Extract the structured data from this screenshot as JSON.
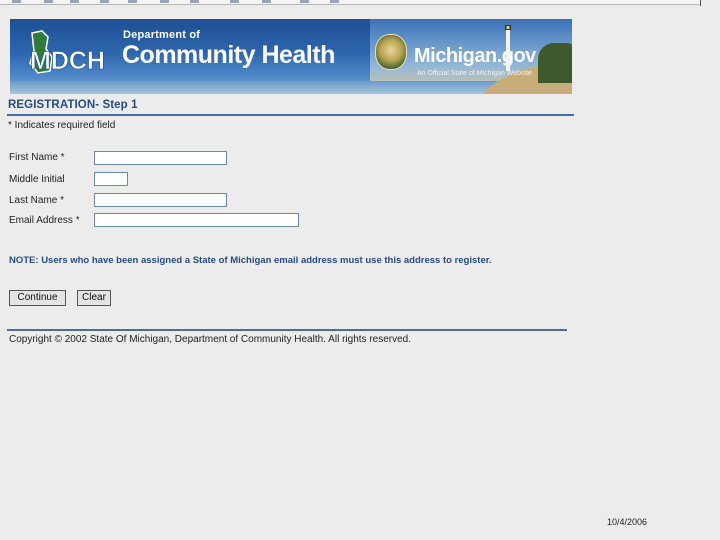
{
  "banner": {
    "mdch_logo": "MDCH",
    "dept_small": "Department of",
    "dept_big": "Community Health",
    "michigan_gov": "Michigan.gov",
    "michigan_tagline": "An Official State of Michigan Website"
  },
  "page": {
    "heading": "REGISTRATION- Step 1",
    "required_note": "* Indicates required field"
  },
  "form": {
    "first_name_label": "First Name *",
    "first_name_value": "",
    "middle_initial_label": "Middle Initial",
    "middle_initial_value": "",
    "last_name_label": "Last Name *",
    "last_name_value": "",
    "email_label": "Email Address *",
    "email_value": ""
  },
  "note": {
    "text": "NOTE: Users who have been assigned a State of Michigan email address must use this address to register."
  },
  "buttons": {
    "continue_label": "Continue",
    "clear_label": "Clear"
  },
  "footer": {
    "copyright": "Copyright © 2002 State Of Michigan, Department of Community Health. All rights reserved."
  },
  "slide": {
    "date": "10/4/2006"
  },
  "colors": {
    "heading": "#274b82",
    "rule": "#4b6c9c",
    "banner_blue": "#2d66ad",
    "background": "#ececec"
  }
}
